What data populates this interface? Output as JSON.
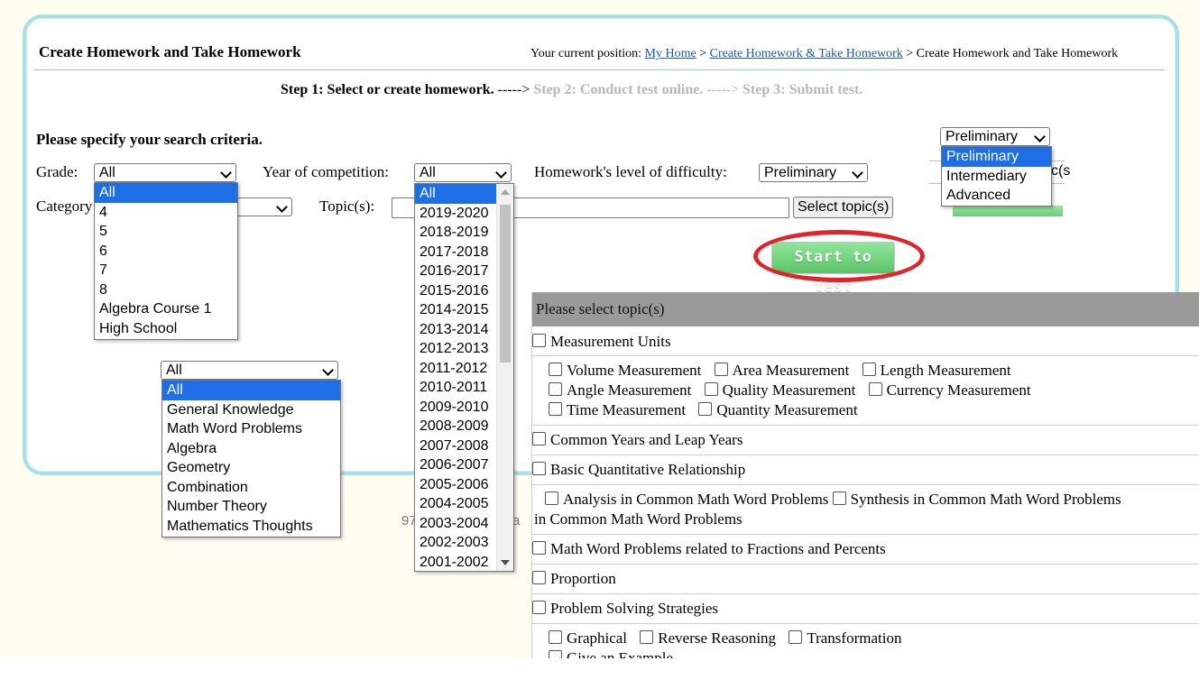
{
  "header": {
    "title": "Create Homework and Take Homework",
    "breadcrumb_prefix": "Your current position:",
    "breadcrumb_home": "My Home",
    "breadcrumb_sep1": ">",
    "breadcrumb_section": "Create Homework & Take Homework",
    "breadcrumb_sep2": ">",
    "breadcrumb_current": "Create Homework and Take Homework"
  },
  "steps": {
    "step1": "Step 1: Select or create homework.",
    "arrow1": "----->",
    "step2": "Step 2: Conduct test online.",
    "arrow2": "----->",
    "step3": "Step 3: Submit test."
  },
  "criteria": {
    "heading": "Please specify your search criteria.",
    "grade_label": "Grade:",
    "grade_value": "All",
    "year_label": "Year of competition:",
    "year_value": "All",
    "difficulty_label": "Homework's level of difficulty:",
    "difficulty_value": "Preliminary",
    "category_label": "Category",
    "topics_label": "Topic(s):",
    "select_topics_button": "Select topic(s)",
    "start_button": "Start to test"
  },
  "grade_options": [
    "All",
    "4",
    "5",
    "6",
    "7",
    "8",
    "Algebra Course 1",
    "High School"
  ],
  "year_options": [
    "All",
    "2019-2020",
    "2018-2019",
    "2017-2018",
    "2016-2017",
    "2015-2016",
    "2014-2015",
    "2013-2014",
    "2012-2013",
    "2011-2012",
    "2010-2011",
    "2009-2010",
    "2008-2009",
    "2007-2008",
    "2006-2007",
    "2005-2006",
    "2004-2005",
    "2003-2004",
    "2002-2003",
    "2001-2002"
  ],
  "category_dropdown": {
    "value": "All",
    "options": [
      "All",
      "General Knowledge",
      "Math Word Problems",
      "Algebra",
      "Geometry",
      "Combination",
      "Number Theory",
      "Mathematics Thoughts"
    ]
  },
  "difficulty_dropdown": {
    "value": "Preliminary",
    "options": [
      "Preliminary",
      "Intermediary",
      "Advanced"
    ],
    "peek_text": "c(s"
  },
  "topic_panel": {
    "heading": "Please select topic(s)",
    "measurement_units": "Measurement Units",
    "measurement_subs": [
      "Volume Measurement",
      "Area Measurement",
      "Length Measurement",
      "Angle Measurement",
      "Quality Measurement",
      "Currency Measurement",
      "Time Measurement",
      "Quantity Measurement"
    ],
    "common_years": "Common Years and Leap Years",
    "basic_quant": "Basic Quantitative Relationship",
    "analysis": "Analysis in Common Math Word Problems",
    "synthesis": "Synthesis in Common Math Word Problems",
    "in_common": "in Common Math Word Problems",
    "fractions": "Math Word Problems related to Fractions and Percents",
    "proportion": "Proportion",
    "strategies": "Problem Solving Strategies",
    "strategy_subs": [
      "Graphical",
      "Reverse Reasoning",
      "Transformation"
    ],
    "cut_off": "Give an Example"
  },
  "footer_peek": {
    "left": "97",
    "right": "a"
  }
}
